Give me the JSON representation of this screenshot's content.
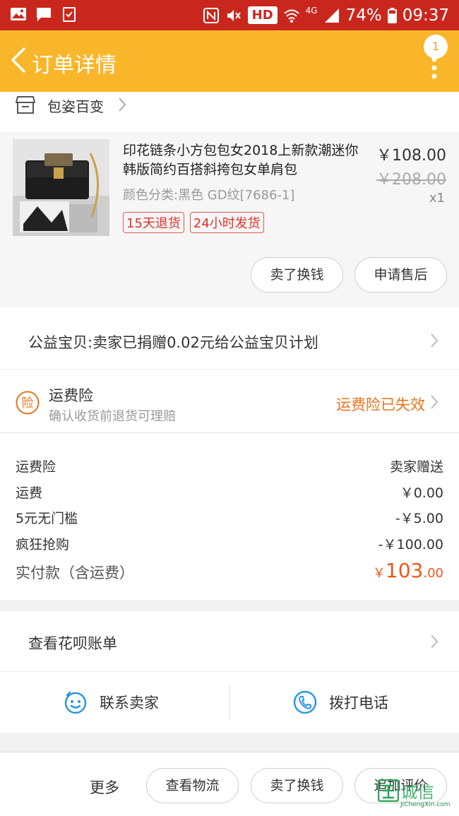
{
  "status_bar": {
    "hd": "HD",
    "network": "4G",
    "battery": "74%",
    "time": "09:37"
  },
  "header": {
    "title": "订单详情",
    "badge_count": "1"
  },
  "shop": {
    "name": "包姿百变"
  },
  "product": {
    "title": "印花链条小方包包女2018上新款潮迷你韩版简约百搭斜挎包女单肩包",
    "spec": "颜色分类:黑色  GD纹[7686-1]",
    "tags": [
      "15天退货",
      "24小时发货"
    ],
    "price": "￥108.00",
    "original_price": "￥208.00",
    "quantity": "x1",
    "actions": {
      "sell": "卖了换钱",
      "after_sale": "申请售后"
    }
  },
  "charity": {
    "text": "公益宝贝:卖家已捐赠0.02元给公益宝贝计划"
  },
  "shipping_insurance": {
    "icon_char": "险",
    "title": "运费险",
    "subtitle": "确认收货前退货可理赔",
    "status": "运费险已失效"
  },
  "breakdown": {
    "rows": [
      {
        "label": "运费险",
        "value": "卖家赠送"
      },
      {
        "label": "运费",
        "value": "￥0.00"
      },
      {
        "label": "5元无门槛",
        "value": "-￥5.00"
      },
      {
        "label": "疯狂抢购",
        "value": "-￥100.00"
      }
    ],
    "total_label": "实付款（含运费）",
    "total_currency": "￥",
    "total_integer": "103",
    "total_decimal": ".00"
  },
  "huabei": {
    "text": "查看花呗账单"
  },
  "contact": {
    "seller": "联系卖家",
    "call": "拨打电话"
  },
  "bottom_bar": {
    "more": "更多",
    "logistics": "查看物流",
    "sell": "卖了换钱",
    "review": "追加评价"
  },
  "watermark": {
    "cn": "诚信",
    "en": "JiChengXin.com"
  },
  "colors": {
    "status_bar": "#c9271e",
    "header": "#f9b62a",
    "accent_orange": "#e8731e",
    "tag_red": "#e0302a",
    "contact_blue": "#2d97e0"
  }
}
